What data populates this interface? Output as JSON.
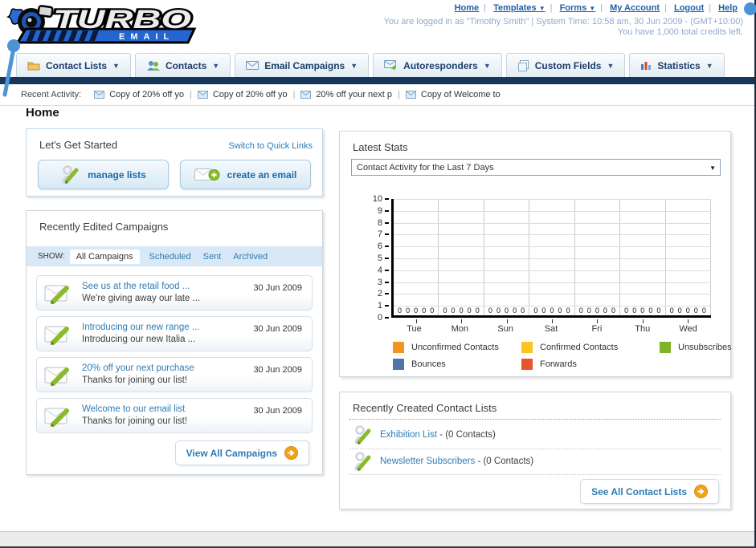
{
  "header": {
    "nav_links": [
      {
        "label": "Home"
      },
      {
        "label": "Templates",
        "has_menu": true
      },
      {
        "label": "Forms",
        "has_menu": true
      },
      {
        "label": "My Account"
      },
      {
        "label": "Logout"
      },
      {
        "label": "Help"
      }
    ],
    "login_line": "You are logged in as \"Timothy Smith\" | System Time: 10:58 am, 30 Jun 2009 - (GMT+10:00)",
    "credits_line": "You have 1,000 total credits left.",
    "logo_word1": "TURBO",
    "logo_word2": "EMAIL"
  },
  "nav_tabs": [
    {
      "label": "Contact Lists",
      "icon": "folder-icon"
    },
    {
      "label": "Contacts",
      "icon": "people-icon"
    },
    {
      "label": "Email Campaigns",
      "icon": "envelope-icon"
    },
    {
      "label": "Autoresponders",
      "icon": "envelope-arrow-icon"
    },
    {
      "label": "Custom Fields",
      "icon": "pages-icon"
    },
    {
      "label": "Statistics",
      "icon": "bar-chart-icon"
    }
  ],
  "recent_activity": {
    "label": "Recent Activity:",
    "items": [
      {
        "text": "Copy of 20% off yo"
      },
      {
        "text": "Copy of 20% off yo"
      },
      {
        "text": "20% off your next p"
      },
      {
        "text": "Copy of Welcome to"
      }
    ]
  },
  "page_title": "Home",
  "get_started": {
    "title": "Let's Get Started",
    "switch_link": "Switch to Quick Links",
    "manage_lists_label": "manage lists",
    "create_email_label": "create an email"
  },
  "campaigns": {
    "title": "Recently Edited Campaigns",
    "show_label": "SHOW:",
    "active_filter": "All Campaigns",
    "filters": [
      {
        "label": "Scheduled"
      },
      {
        "label": "Sent"
      },
      {
        "label": "Archived"
      }
    ],
    "items": [
      {
        "title": "See us at the retail food ...",
        "subtitle": "We're giving away our late ...",
        "date": "30 Jun 2009"
      },
      {
        "title": "Introducing our new range ...",
        "subtitle": "Introducing our new Italia ...",
        "date": "30 Jun 2009"
      },
      {
        "title": "20% off your next purchase",
        "subtitle": "Thanks for joining our list!",
        "date": "30 Jun 2009"
      },
      {
        "title": "Welcome to our email list",
        "subtitle": "Thanks for joining our list!",
        "date": "30 Jun 2009"
      }
    ],
    "view_all_label": "View All Campaigns"
  },
  "latest_stats": {
    "title": "Latest Stats",
    "dropdown_value": "Contact Activity for the Last 7 Days"
  },
  "chart_data": {
    "type": "bar",
    "categories": [
      "Tue",
      "Mon",
      "Sun",
      "Sat",
      "Fri",
      "Thu",
      "Wed"
    ],
    "series": [
      {
        "name": "Unconfirmed Contacts",
        "color": "#f6921e",
        "values": [
          0,
          0,
          0,
          0,
          0,
          0,
          0
        ]
      },
      {
        "name": "Confirmed Contacts",
        "color": "#fdc31f",
        "values": [
          0,
          0,
          0,
          0,
          0,
          0,
          0
        ]
      },
      {
        "name": "Unsubscribes",
        "color": "#7fb12a",
        "values": [
          0,
          0,
          0,
          0,
          0,
          0,
          0
        ]
      },
      {
        "name": "Bounces",
        "color": "#5272a9",
        "values": [
          0,
          0,
          0,
          0,
          0,
          0,
          0
        ]
      },
      {
        "name": "Forwards",
        "color": "#e8542e",
        "values": [
          0,
          0,
          0,
          0,
          0,
          0,
          0
        ]
      }
    ],
    "title": "Contact Activity for the Last 7 Days",
    "xlabel": "",
    "ylabel": "",
    "ylim": [
      0,
      10
    ],
    "ytick_step": 1,
    "grid": true,
    "legend_position": "bottom",
    "note": "all values are zero; each day shows five 0 value labels above the baseline"
  },
  "contact_lists": {
    "title": "Recently Created Contact Lists",
    "items": [
      {
        "name": "Exhibition List",
        "count": "- (0 Contacts)"
      },
      {
        "name": "Newsletter Subscribers",
        "count": "- (0 Contacts)"
      }
    ],
    "see_all_label": "See All Contact Lists"
  },
  "colors": {
    "navy_bar": "#17365c",
    "link_blue": "#2e7cb5",
    "header_link_blue": "#1f5fa9",
    "button_arrow_orange": "#f0a21c",
    "filter_bar_blue": "#d9e8f6",
    "decor_blue": "#4d94d6"
  }
}
